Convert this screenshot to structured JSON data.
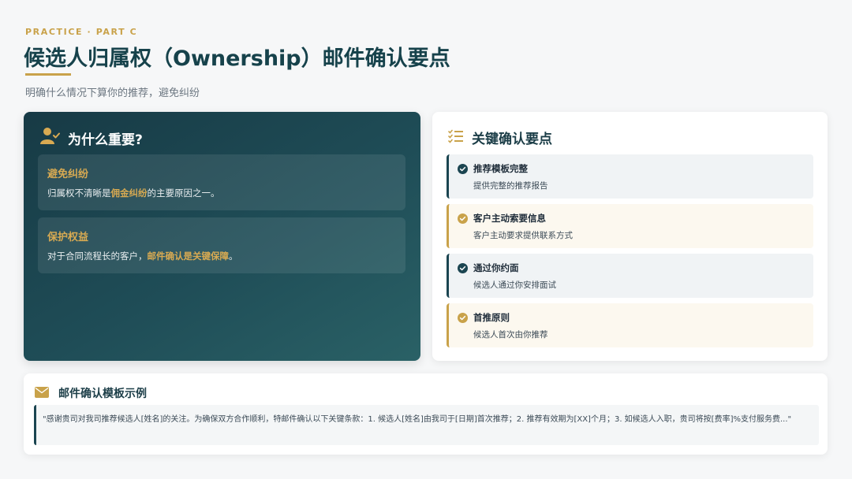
{
  "header": {
    "eyebrow": "PRACTICE · PART C",
    "title": "候选人归属权（Ownership）邮件确认要点",
    "subtitle": "明确什么情况下算你的推荐，避免纠纷"
  },
  "why": {
    "title": "为什么重要?",
    "icon": "user-check-icon",
    "items": [
      {
        "title": "避免纠纷",
        "text_before": "归属权不清晰是",
        "highlight": "佣金纠纷",
        "text_after": "的主要原因之一。"
      },
      {
        "title": "保护权益",
        "text_before": "对于合同流程长的客户，",
        "highlight": "邮件确认是关键保障",
        "text_after": "。"
      }
    ]
  },
  "points": {
    "title": "关键确认要点",
    "icon": "checklist-icon",
    "items": [
      {
        "title": "推荐模板完整",
        "desc": "提供完整的推荐报告",
        "accent": "navy"
      },
      {
        "title": "客户主动索要信息",
        "desc": "客户主动要求提供联系方式",
        "accent": "gold"
      },
      {
        "title": "通过你约面",
        "desc": "候选人通过你安排面试",
        "accent": "navy"
      },
      {
        "title": "首推原则",
        "desc": "候选人首次由你推荐",
        "accent": "gold"
      }
    ]
  },
  "template": {
    "title": "邮件确认模板示例",
    "icon": "envelope-icon",
    "quote": "\"感谢贵司对我司推荐候选人[姓名]的关注。为确保双方合作顺利，特邮件确认以下关键条款：1. 候选人[姓名]由我司于[日期]首次推荐；2. 推荐有效期为[XX]个月；3. 如候选人入职，贵司将按[费率]%支付服务费...\""
  },
  "colors": {
    "gold": "#c9a24a",
    "navy": "#1b4551",
    "dark_teal": "#173a45"
  }
}
